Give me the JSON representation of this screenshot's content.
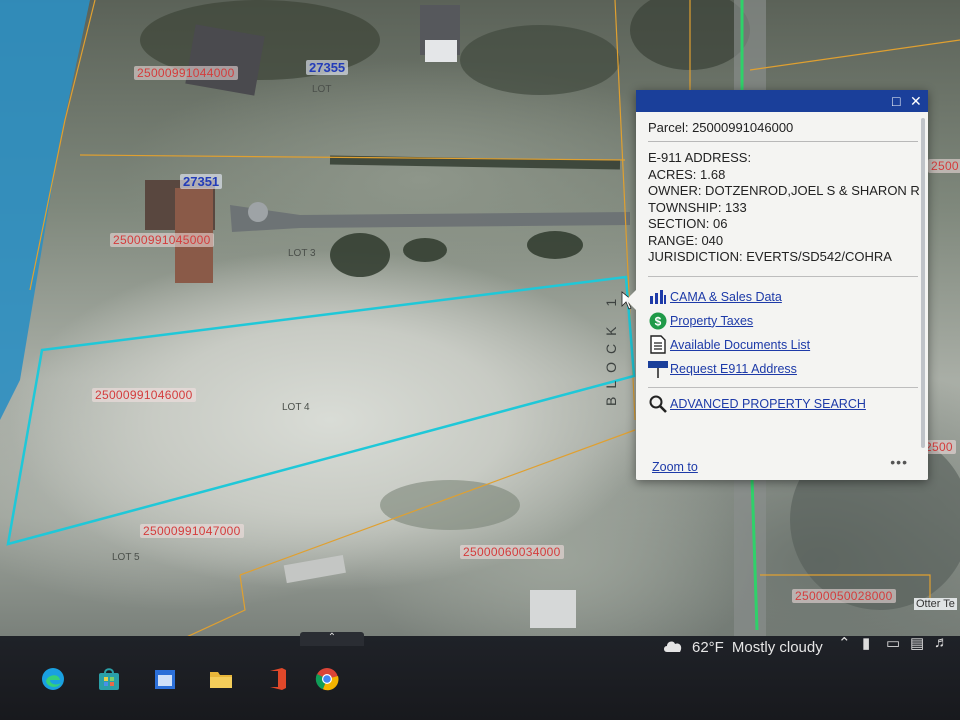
{
  "map": {
    "parcel_ids": [
      "25000991044000",
      "25000991045000",
      "25000991046000",
      "25000991047000",
      "25000060034000",
      "25000050028000",
      "2500"
    ],
    "address_numbers": [
      "27355",
      "27351"
    ],
    "lots": [
      "LOT 3",
      "LOT 4",
      "LOT 5",
      "LOT"
    ],
    "block_label": "BLOCK 1",
    "road_label": "Otter Te",
    "colors": {
      "selected_outline": "#1fc8d8",
      "parcel_lines": "#e0a030",
      "parcel_id_text": "#d43c3c",
      "address_text": "#233cb8"
    }
  },
  "popup": {
    "header_icons": [
      "maximize-icon",
      "close-icon"
    ],
    "parcel_title": "Parcel: 25000991046000",
    "attributes": [
      "E-911 ADDRESS:",
      "ACRES: 1.68",
      "OWNER: DOTZENROD,JOEL S & SHARON R",
      "TOWNSHIP: 133",
      "SECTION: 06",
      "RANGE: 040",
      "JURISDICTION: EVERTS/SD542/COHRA"
    ],
    "links": [
      {
        "label": "CAMA & Sales Data",
        "icon": "bar-chart-icon"
      },
      {
        "label": "Property Taxes",
        "icon": "dollar-icon"
      },
      {
        "label": "Available Documents List",
        "icon": "document-icon"
      },
      {
        "label": "Request E911 Address",
        "icon": "e911-sign-icon"
      }
    ],
    "search_link": {
      "label": "ADVANCED PROPERTY SEARCH",
      "icon": "magnifier-icon"
    },
    "zoom_label": "Zoom to",
    "more_label": "•••",
    "header_color": "#1a3f9a"
  },
  "taskbar": {
    "apps": [
      "edge-icon",
      "store-icon",
      "calendar-icon",
      "file-explorer-icon",
      "office-icon",
      "chrome-icon"
    ],
    "weather": {
      "temp": "62°F",
      "condition": "Mostly cloudy",
      "icon": "cloud-icon"
    }
  }
}
